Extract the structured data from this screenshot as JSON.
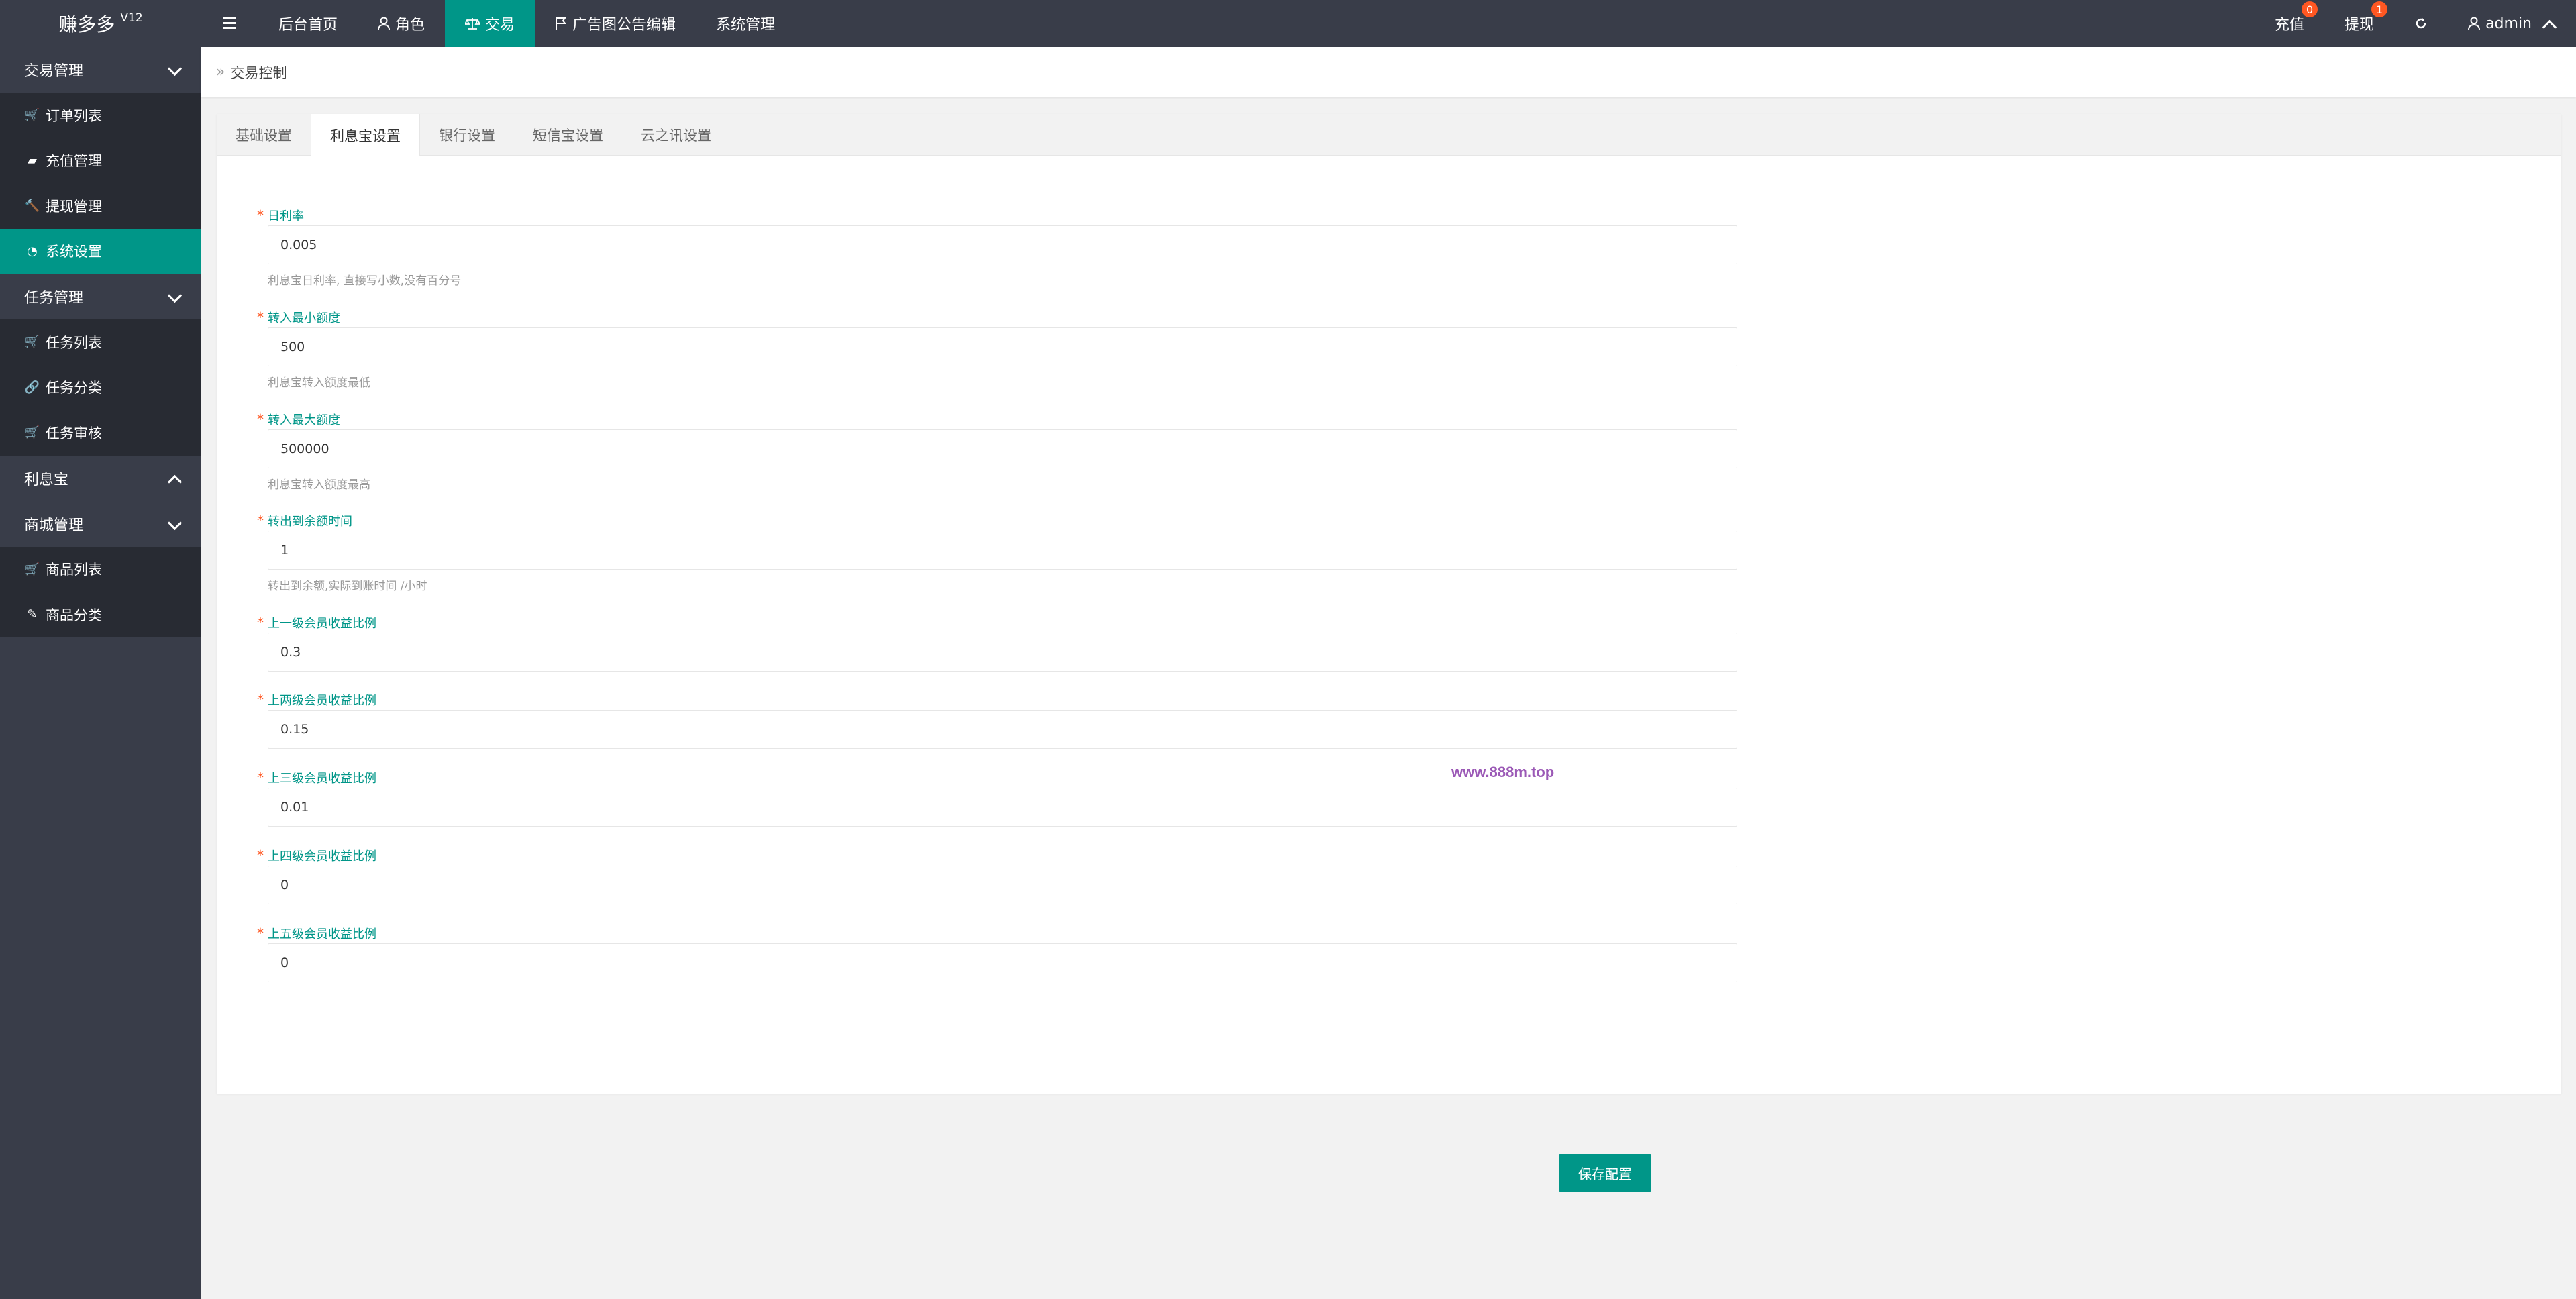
{
  "app": {
    "name": "赚多多",
    "version": "V12"
  },
  "topnav": [
    {
      "label": "后台首页",
      "icon": ""
    },
    {
      "label": "角色",
      "icon": "user-icon"
    },
    {
      "label": "交易",
      "icon": "scale-icon"
    },
    {
      "label": "广告图公告编辑",
      "icon": "flag-icon"
    },
    {
      "label": "系统管理",
      "icon": ""
    }
  ],
  "topright": {
    "recharge": {
      "label": "充值",
      "badge": "0"
    },
    "withdraw": {
      "label": "提现",
      "badge": "1"
    },
    "user": "admin"
  },
  "sidebar": {
    "trade_group": "交易管理",
    "trade_items": [
      "订单列表",
      "充值管理",
      "提现管理",
      "系统设置"
    ],
    "task_group": "任务管理",
    "task_items": [
      "任务列表",
      "任务分类",
      "任务审核"
    ],
    "interest_group": "利息宝",
    "mall_group": "商城管理",
    "mall_items": [
      "商品列表",
      "商品分类"
    ]
  },
  "breadcrumb": "交易控制",
  "tabs": [
    "基础设置",
    "利息宝设置",
    "银行设置",
    "短信宝设置",
    "云之讯设置"
  ],
  "fields": [
    {
      "label": "日利率",
      "value": "0.005",
      "help": "利息宝日利率, 直接写小数,没有百分号"
    },
    {
      "label": "转入最小额度",
      "value": "500",
      "help": "利息宝转入额度最低"
    },
    {
      "label": "转入最大额度",
      "value": "500000",
      "help": "利息宝转入额度最高"
    },
    {
      "label": "转出到余额时间",
      "value": "1",
      "help": "转出到余额,实际到账时间 /小时"
    },
    {
      "label": "上一级会员收益比例",
      "value": "0.3",
      "help": ""
    },
    {
      "label": "上两级会员收益比例",
      "value": "0.15",
      "help": ""
    },
    {
      "label": "上三级会员收益比例",
      "value": "0.01",
      "help": ""
    },
    {
      "label": "上四级会员收益比例",
      "value": "0",
      "help": ""
    },
    {
      "label": "上五级会员收益比例",
      "value": "0",
      "help": ""
    }
  ],
  "watermark": "www.888m.top",
  "save_label": "保存配置",
  "colors": {
    "accent": "#009688",
    "header": "#393d49",
    "badge": "#ff5722"
  }
}
